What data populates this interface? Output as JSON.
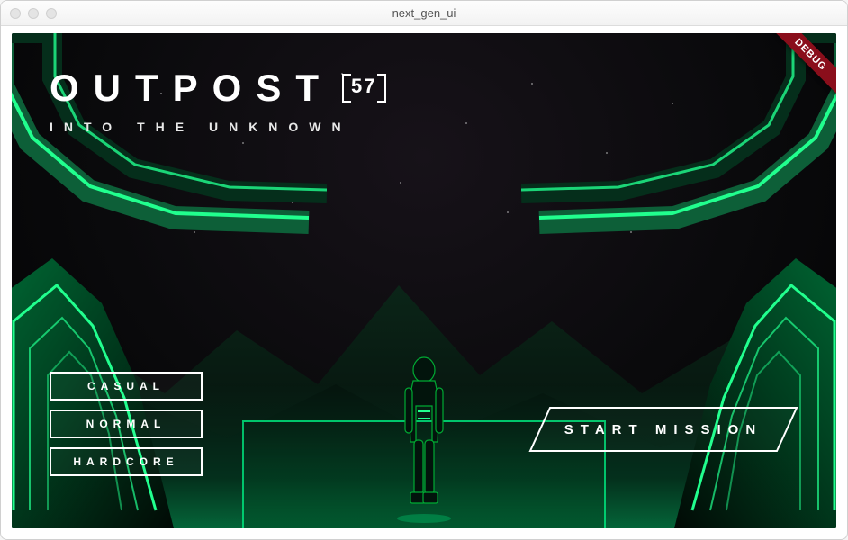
{
  "window": {
    "title": "next_gen_ui"
  },
  "debug": {
    "label": "DEBUG"
  },
  "title": {
    "main": "OUTPOST",
    "number": "57",
    "subtitle": "INTO THE UNKNOWN"
  },
  "difficulty": {
    "options": [
      {
        "label": "CASUAL"
      },
      {
        "label": "NORMAL"
      },
      {
        "label": "HARDCORE"
      }
    ]
  },
  "start": {
    "label": "START MISSION"
  },
  "colors": {
    "neon": "#21ff8e",
    "neon_dark": "#0a6b3f",
    "debug_ribbon": "#8a0e1b"
  }
}
